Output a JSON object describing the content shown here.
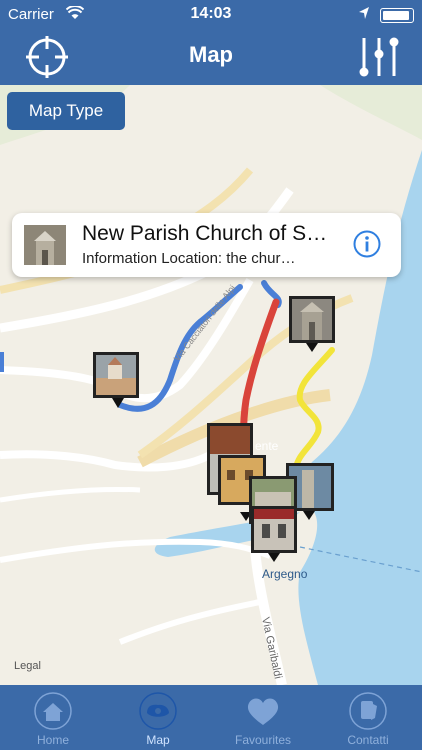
{
  "status": {
    "carrier": "Carrier",
    "time": "14:03"
  },
  "nav": {
    "title": "Map",
    "left_icon": "crosshair-icon",
    "right_icon": "sliders-icon"
  },
  "map": {
    "map_type_label": "Map Type",
    "legal": "Legal",
    "labels": {
      "argegno": "Argegno",
      "via_garibaldi": "Via Garibaldi",
      "via_cacciatori": "Via Cacciatori delle Alpi",
      "ente": "ente"
    },
    "callout": {
      "title": "New Parish Church of S…",
      "subtitle": "Information Location: the chur…"
    }
  },
  "tabs": [
    {
      "label": "Home",
      "icon": "home-icon"
    },
    {
      "label": "Map",
      "icon": "map-icon"
    },
    {
      "label": "Favourites",
      "icon": "heart-icon"
    },
    {
      "label": "Contatti",
      "icon": "phone-icon"
    }
  ],
  "colors": {
    "bar": "#3b6aa8",
    "tab_label": "#8fb0dc",
    "route_blue": "#4a7fd6",
    "route_red": "#d9443b",
    "route_yellow": "#f2e43a",
    "water": "#a8d4ee"
  }
}
